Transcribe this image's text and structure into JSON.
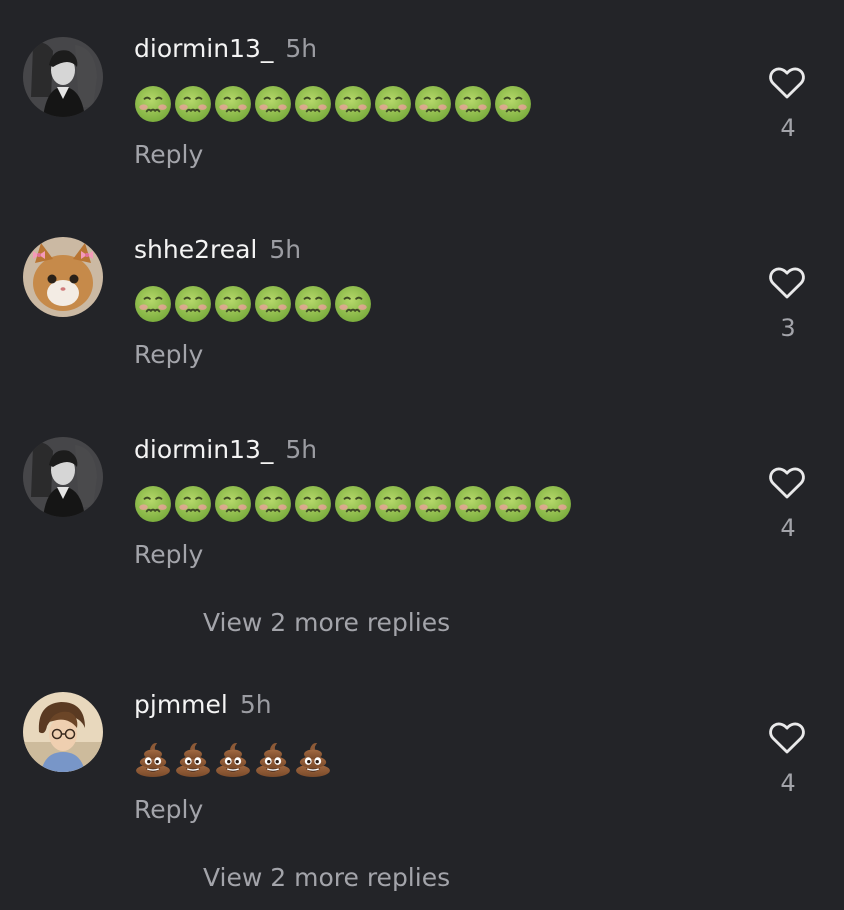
{
  "colors": {
    "background": "#232428",
    "text_primary": "#f4f4f4",
    "text_secondary": "#a3a4aa",
    "nauseated_green": "#8bc34a",
    "poop_brown": "#8d5a37"
  },
  "comments": [
    {
      "username": "diormin13_",
      "time": "5h",
      "emoji_name": "nauseated-face",
      "emoji_count": 10,
      "reply_label": "Reply",
      "likes": "4",
      "avatar": "grayscale-photo-person"
    },
    {
      "username": "shhe2real",
      "time": "5h",
      "emoji_name": "nauseated-face",
      "emoji_count": 6,
      "reply_label": "Reply",
      "likes": "3",
      "avatar": "kitten-with-bows"
    },
    {
      "username": "diormin13_",
      "time": "5h",
      "emoji_name": "nauseated-face",
      "emoji_count": 11,
      "reply_label": "Reply",
      "likes": "4",
      "avatar": "grayscale-photo-person",
      "view_more": "View 2 more replies"
    },
    {
      "username": "pjmmel",
      "time": "5h",
      "emoji_name": "pile-of-poo",
      "emoji_count": 5,
      "reply_label": "Reply",
      "likes": "4",
      "avatar": "photo-person-glasses",
      "view_more": "View 2 more replies"
    }
  ]
}
